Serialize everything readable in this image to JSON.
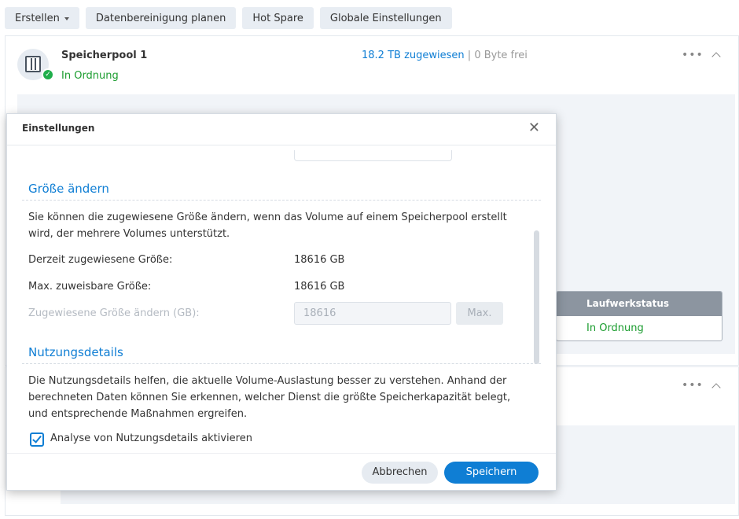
{
  "toolbar": {
    "create": "Erstellen",
    "data_cleanup": "Datenbereinigung planen",
    "hot_spare": "Hot Spare",
    "global_settings": "Globale Einstellungen"
  },
  "pool": {
    "title": "Speicherpool 1",
    "status": "In Ordnung",
    "allocated": "18.2 TB zugewiesen",
    "separator": "|",
    "free": "0 Byte frei",
    "more": "•••"
  },
  "drive_table": {
    "header": "Laufwerkstatus",
    "status": "In Ordnung"
  },
  "card2": {
    "more": "•••"
  },
  "dialog": {
    "title": "Einstellungen",
    "resize": {
      "title": "Größe ändern",
      "description": "Sie können die zugewiesene Größe ändern, wenn das Volume auf einem Speicherpool erstellt wird, der mehrere Volumes unterstützt.",
      "current_label": "Derzeit zugewiesene Größe:",
      "current_value": "18616 GB",
      "max_label": "Max. zuweisbare Größe:",
      "max_value": "18616 GB",
      "change_label": "Zugewiesene Größe ändern (GB):",
      "change_value": "18616",
      "max_button": "Max."
    },
    "usage": {
      "title": "Nutzungsdetails",
      "description": "Die Nutzungsdetails helfen, die aktuelle Volume-Auslastung besser zu verstehen. Anhand der berechneten Daten können Sie erkennen, welcher Dienst die größte Speicherkapazität belegt, und entsprechende Maßnahmen ergreifen.",
      "checkbox_label": "Analyse von Nutzungsdetails aktivieren",
      "checkbox_checked": true
    },
    "cancel": "Abbrechen",
    "save": "Speichern"
  },
  "colors": {
    "accent": "#0f7ed4",
    "status_ok": "#1a9c2e"
  }
}
